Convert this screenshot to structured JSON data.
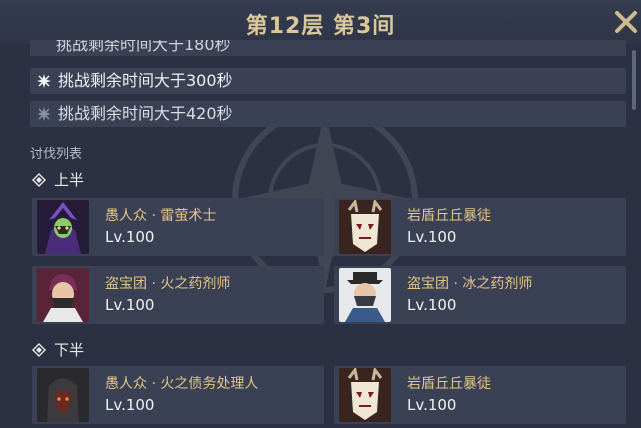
{
  "header": {
    "title": "第12层 第3间"
  },
  "conditions": {
    "partial": "挑战剩余时间大于180秒",
    "items": [
      {
        "label": "挑战剩余时间大于300秒",
        "icon": "star-icon",
        "achieved": true
      },
      {
        "label": "挑战剩余时间大于420秒",
        "icon": "star-icon",
        "achieved": false
      }
    ]
  },
  "enemies": {
    "section_title": "讨伐列表",
    "first_half": {
      "label": "上半",
      "list": [
        {
          "name": "愚人众 · 雷萤术士",
          "level": "Lv.100",
          "icon": "electro-cicin-mage-portrait"
        },
        {
          "name": "岩盾丘丘暴徒",
          "level": "Lv.100",
          "icon": "geo-mitachurl-portrait"
        },
        {
          "name": "盗宝团 · 火之药剂师",
          "level": "Lv.100",
          "icon": "pyro-potioneer-portrait"
        },
        {
          "name": "盗宝团 · 冰之药剂师",
          "level": "Lv.100",
          "icon": "cryo-potioneer-portrait"
        }
      ]
    },
    "second_half": {
      "label": "下半",
      "list": [
        {
          "name": "愚人众 · 火之债务处理人",
          "level": "Lv.100",
          "icon": "pyro-agent-portrait"
        },
        {
          "name": "岩盾丘丘暴徒",
          "level": "Lv.100",
          "icon": "geo-mitachurl-portrait"
        }
      ]
    }
  },
  "colors": {
    "background": "#2b3142",
    "card": "#3a4154",
    "title": "#d8c79a",
    "enemy_name": "#e2c48a"
  }
}
